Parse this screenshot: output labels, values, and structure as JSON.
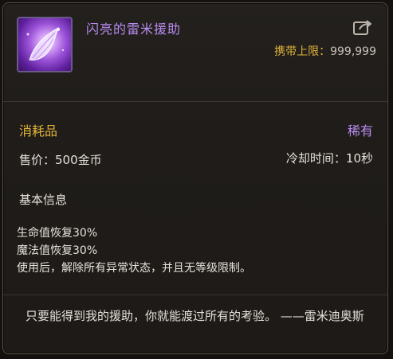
{
  "item": {
    "name": "闪亮的雷米援助",
    "icon": "crystal-wing-icon",
    "carry_limit_label": "携带上限：",
    "carry_limit_value": "999,999",
    "category": "消耗品",
    "rarity": "稀有",
    "price": "售价：500金币",
    "cooldown": "冷却时间：10秒"
  },
  "info": {
    "title": "基本信息",
    "effects": [
      "生命值恢复30%",
      "魔法值恢复30%",
      "使用后，解除所有异常状态，并且无等级限制。"
    ]
  },
  "quote": "只要能得到我的援助，你就能渡过所有的考验。 ——雷米迪奥斯",
  "colors": {
    "name": "#b98cf2",
    "accent_gold": "#e0b43a",
    "rarity": "#b98cf2",
    "text": "#e6e1da"
  },
  "header_icons": [
    "share-icon"
  ]
}
